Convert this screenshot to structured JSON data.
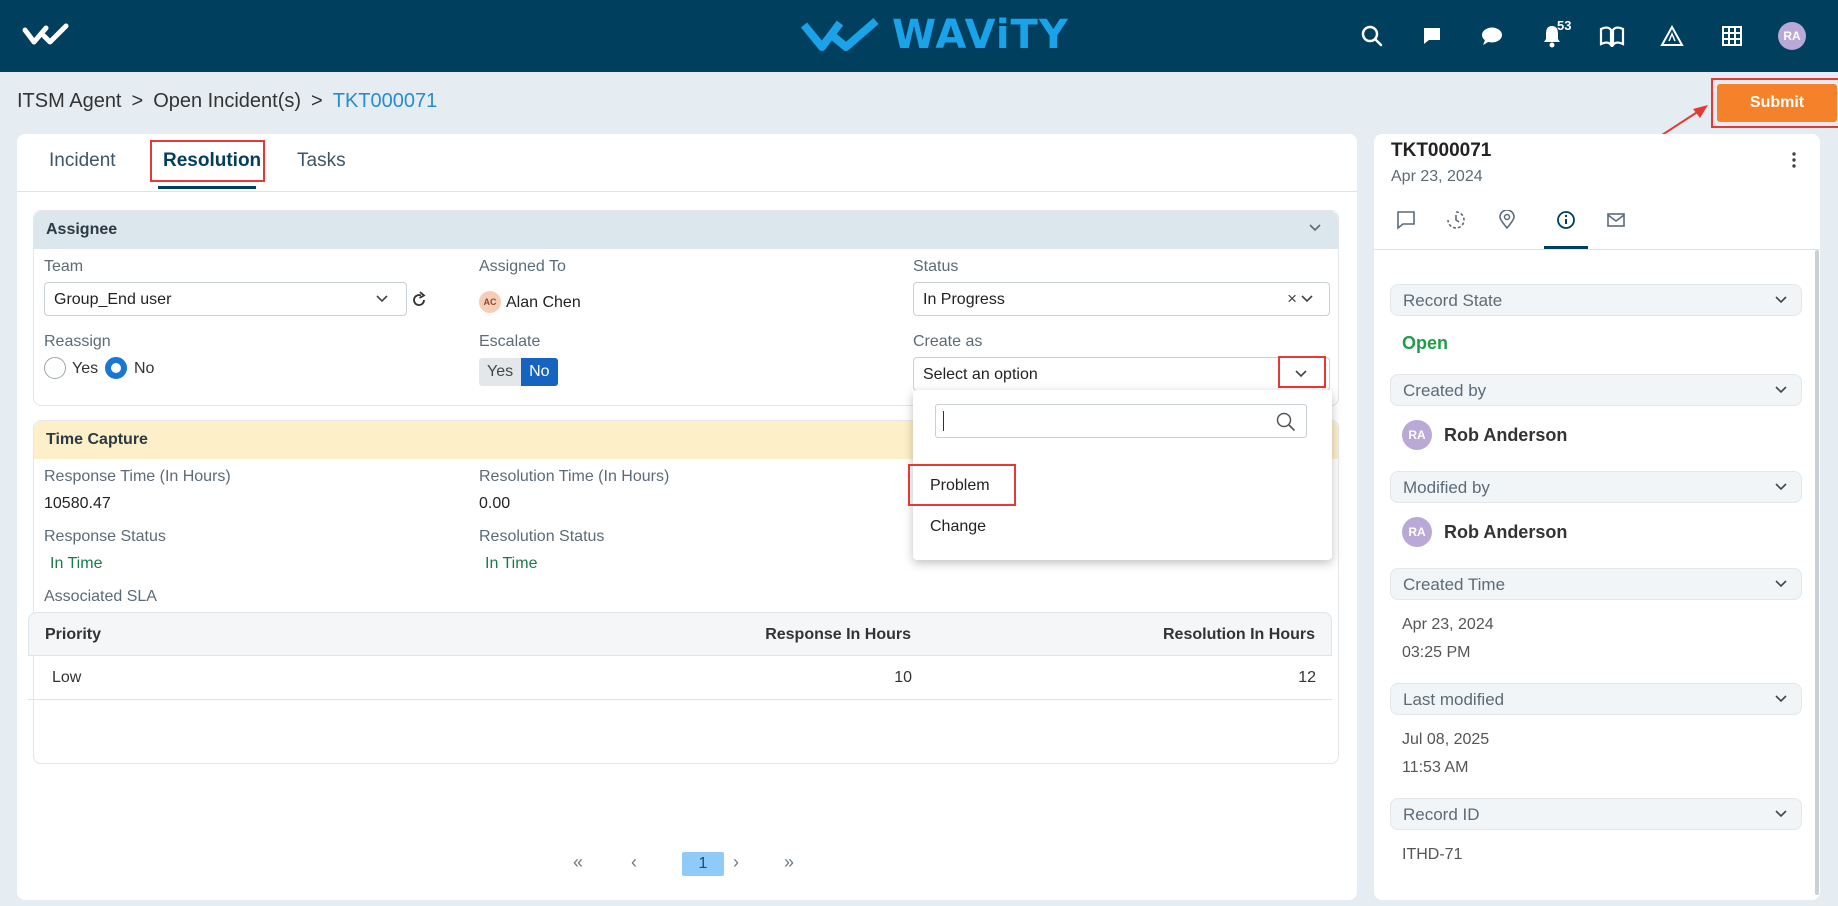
{
  "header": {
    "brand": "WAViTY",
    "notification_count": "53",
    "avatar_initials": "RA",
    "icons": [
      "search-icon",
      "chat-bubble-icon",
      "messages-icon",
      "bell-icon",
      "book-icon",
      "alert-triangle-icon",
      "apps-grid-icon"
    ]
  },
  "breadcrumb": {
    "items": [
      "ITSM Agent",
      "Open Incident(s)"
    ],
    "separator": ">",
    "current": "TKT000071"
  },
  "submit_label": "Submit",
  "tabs": [
    {
      "label": "Incident"
    },
    {
      "label": "Resolution"
    },
    {
      "label": "Tasks"
    }
  ],
  "assignee": {
    "title": "Assignee",
    "team_label": "Team",
    "team_value": "Group_End user",
    "assigned_label": "Assigned To",
    "assigned_initials": "AC",
    "assigned_name": "Alan Chen",
    "status_label": "Status",
    "status_value": "In Progress",
    "reassign_label": "Reassign",
    "reassign_yes": "Yes",
    "reassign_no": "No",
    "escalate_label": "Escalate",
    "escalate_yes": "Yes",
    "escalate_no": "No",
    "create_as_label": "Create as",
    "create_as_placeholder": "Select an option"
  },
  "dropdown": {
    "options": [
      "Problem",
      "Change"
    ]
  },
  "time_capture": {
    "title": "Time Capture",
    "response_time_label": "Response Time (In Hours)",
    "response_time_value": "10580.47",
    "resolution_time_label": "Resolution Time (In Hours)",
    "resolution_time_value": "0.00",
    "response_status_label": "Response Status",
    "response_status_value": "In Time",
    "resolution_status_label": "Resolution Status",
    "resolution_status_value": "In Time",
    "sla_label": "Associated SLA"
  },
  "sla_table": {
    "columns": [
      "Priority",
      "Response In Hours",
      "Resolution In Hours"
    ],
    "rows": [
      [
        "Low",
        "10",
        "12"
      ]
    ]
  },
  "pager": {
    "current": "1"
  },
  "sidebar": {
    "ticket_id": "TKT000071",
    "ticket_date": "Apr 23, 2024",
    "record_state_label": "Record State",
    "record_state_value": "Open",
    "created_by_label": "Created by",
    "created_by_initials": "RA",
    "created_by_name": "Rob Anderson",
    "modified_by_label": "Modified by",
    "modified_by_initials": "RA",
    "modified_by_name": "Rob Anderson",
    "created_time_label": "Created Time",
    "created_date": "Apr 23, 2024",
    "created_time": "03:25 PM",
    "last_modified_label": "Last modified",
    "modified_date": "Jul 08, 2025",
    "modified_time": "11:53 AM",
    "record_id_label": "Record ID",
    "record_id_value": "ITHD-71"
  },
  "colors": {
    "topbar": "#003f5e",
    "brand": "#1aa3e8",
    "submit": "#f5822a",
    "highlight": "#e53935",
    "open_status": "#1e9e4a"
  }
}
